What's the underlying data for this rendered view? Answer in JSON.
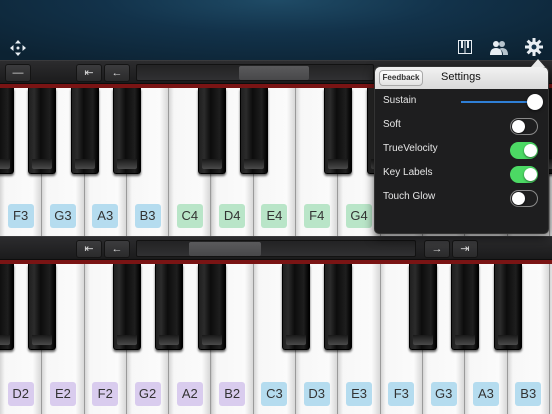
{
  "toolbar": {
    "move_icon": "move-arrows-icon",
    "piano_icon": "piano-keys-icon",
    "users_icon": "two-users-icon",
    "settings_icon": "gear-icon"
  },
  "strip_top": {
    "minus_label": "—",
    "double_left_label": "⇤",
    "left_label": "←"
  },
  "strip_bottom": {
    "double_left_label": "⇤",
    "left_label": "←",
    "right_label": "→",
    "double_right_label": "⇥"
  },
  "keyboard_top": {
    "labels": [
      "F3",
      "G3",
      "A3",
      "B3",
      "C4",
      "D4",
      "E4",
      "F4",
      "G4"
    ]
  },
  "keyboard_bottom": {
    "labels": [
      "D2",
      "E2",
      "F2",
      "G2",
      "A2",
      "B2",
      "C3",
      "D3",
      "E3",
      "F3",
      "G3",
      "A3",
      "B3"
    ]
  },
  "settings": {
    "feedback_label": "Feedback",
    "title": "Settings",
    "sustain": {
      "label": "Sustain",
      "level": 0.92
    },
    "rows": [
      {
        "label": "Soft",
        "on": false
      },
      {
        "label": "TrueVelocity",
        "on": true
      },
      {
        "label": "Key Labels",
        "on": true
      },
      {
        "label": "Touch Glow",
        "on": false
      }
    ]
  },
  "colors": {
    "octave_blue": "#b5dcef",
    "octave_green": "#b9e5c8",
    "octave_purple": "#d9ccee",
    "toggle_on": "#4cd964",
    "slider_fill": "#2f7fd6",
    "keyboard_rail": "#7a1414"
  }
}
